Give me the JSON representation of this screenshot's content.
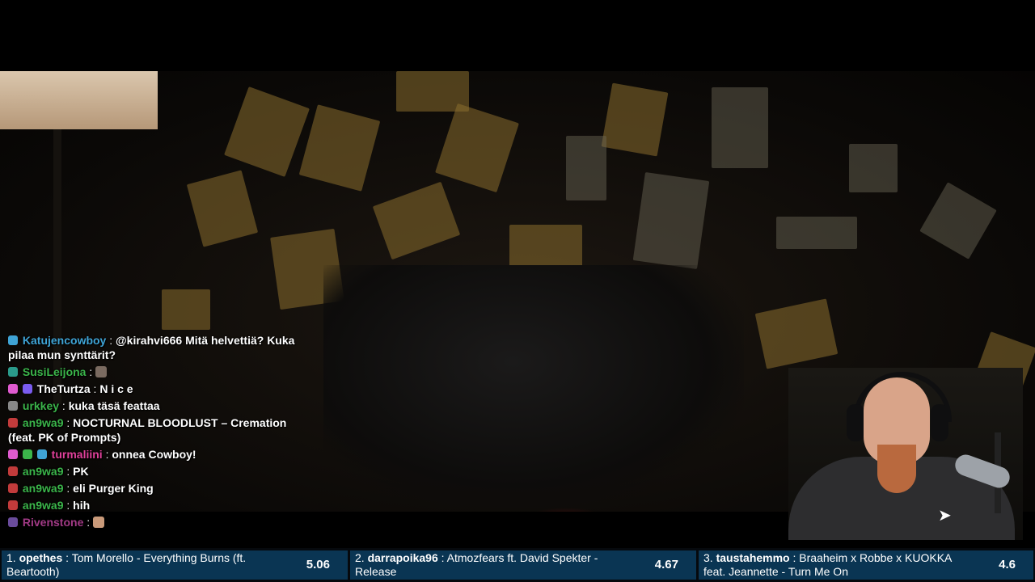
{
  "chat": {
    "lines": [
      {
        "user": "Katujencowboy",
        "message": "@kirahvi666 Mitä helvettiä? Kuka pilaa mun synttärit?",
        "user_color": "#3fa4d6"
      },
      {
        "user": "SusiLeijona",
        "message": "",
        "user_color": "#3bb54a"
      },
      {
        "user": "TheTurtza",
        "message": "N i c e",
        "user_color": "#ffffff"
      },
      {
        "user": "urkkey",
        "message": "kuka täsä feattaa",
        "user_color": "#3bb54a"
      },
      {
        "user": "an9wa9",
        "message": "NOCTURNAL BLOODLUST – Cremation (feat. PK of Prompts)",
        "user_color": "#3bb54a"
      },
      {
        "user": "turmaliini",
        "message": "onnea Cowboy!",
        "user_color": "#e0409a"
      },
      {
        "user": "an9wa9",
        "message": "PK",
        "user_color": "#3bb54a"
      },
      {
        "user": "an9wa9",
        "message": "eli Purger King",
        "user_color": "#3bb54a"
      },
      {
        "user": "an9wa9",
        "message": "hih",
        "user_color": "#3bb54a"
      },
      {
        "user": "Rivenstone",
        "message": "",
        "user_color": "#a23a86"
      }
    ]
  },
  "requests": [
    {
      "rank": "1.",
      "user": "opethes",
      "song": "Tom Morello - Everything Burns (ft. Beartooth)",
      "score": "5.06"
    },
    {
      "rank": "2.",
      "user": "darrapoika96",
      "song": "Atmozfears ft. David Spekter - Release",
      "score": "4.67"
    },
    {
      "rank": "3.",
      "user": "taustahemmo",
      "song": "Braaheim x Robbe x KUOKKA feat. Jeannette - Turn Me On",
      "score": "4.6"
    }
  ],
  "colors": {
    "accent": "#0a3553",
    "background": "#000000"
  },
  "icons": {
    "webcam_logo": "puma-icon"
  }
}
